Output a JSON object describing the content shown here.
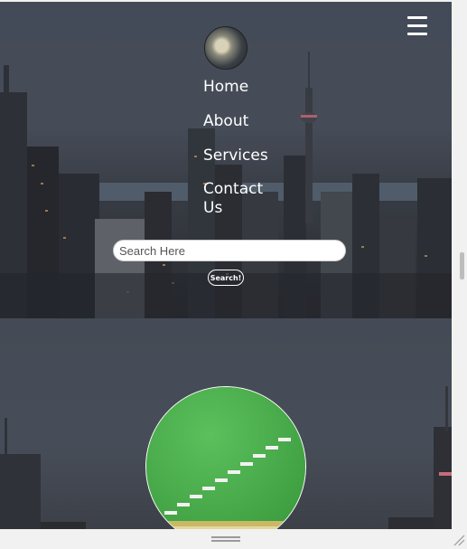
{
  "nav": {
    "menu_icon": "hamburger-menu-icon",
    "avatar_icon": "avatar-image",
    "items": [
      "Home",
      "About",
      "Services",
      "Contact Us"
    ]
  },
  "search": {
    "placeholder": "Search Here",
    "value": "",
    "button_label": "Search!"
  },
  "colors": {
    "accent_green": "#4aab4a",
    "text_white": "#ffffff"
  }
}
